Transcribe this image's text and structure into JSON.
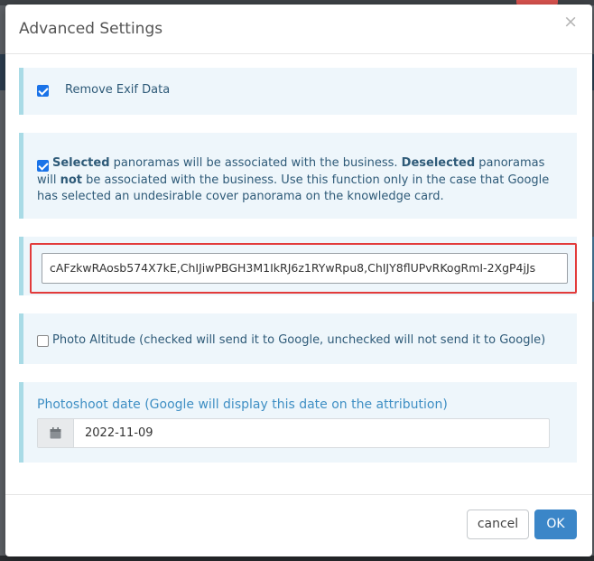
{
  "dialog": {
    "title": "Advanced Settings",
    "close_glyph": "×"
  },
  "settings": {
    "remove_exif": {
      "label": "Remove Exif Data",
      "checked": true
    },
    "association": {
      "checked": true,
      "part1_bold": "Selected",
      "part2": " panoramas will be associated with the business. ",
      "part3_bold": "Deselected",
      "part4": " panoramas will ",
      "part5_bold": "not",
      "part6": " be associated with the business. Use this function only in the case that Google has selected an undesirable cover panorama on the knowledge card."
    },
    "panorama_ids": {
      "value": "cAFzkwRAosb574X7kE,ChIJiwPBGH3M1IkRJ6z1RYwRpu8,ChIJY8flUPvRKogRmI-2XgP4jJs"
    },
    "photo_altitude": {
      "label": "Photo Altitude (checked will send it to Google, unchecked will not send it to Google)",
      "checked": false
    },
    "photoshoot_date": {
      "label": "Photoshoot date (Google will display this date on the attribution)",
      "value": "2022-11-09"
    }
  },
  "footer": {
    "cancel_label": "cancel",
    "ok_label": "OK"
  },
  "icons": {
    "close": "close-icon",
    "calendar": "calendar-icon",
    "checkbox": "checkbox"
  },
  "colors": {
    "panel_bg": "#eef6fb",
    "panel_border": "#a9dbe6",
    "highlight": "#e23b3b",
    "primary": "#3b86c8",
    "checkbox": "#1a73e8"
  }
}
